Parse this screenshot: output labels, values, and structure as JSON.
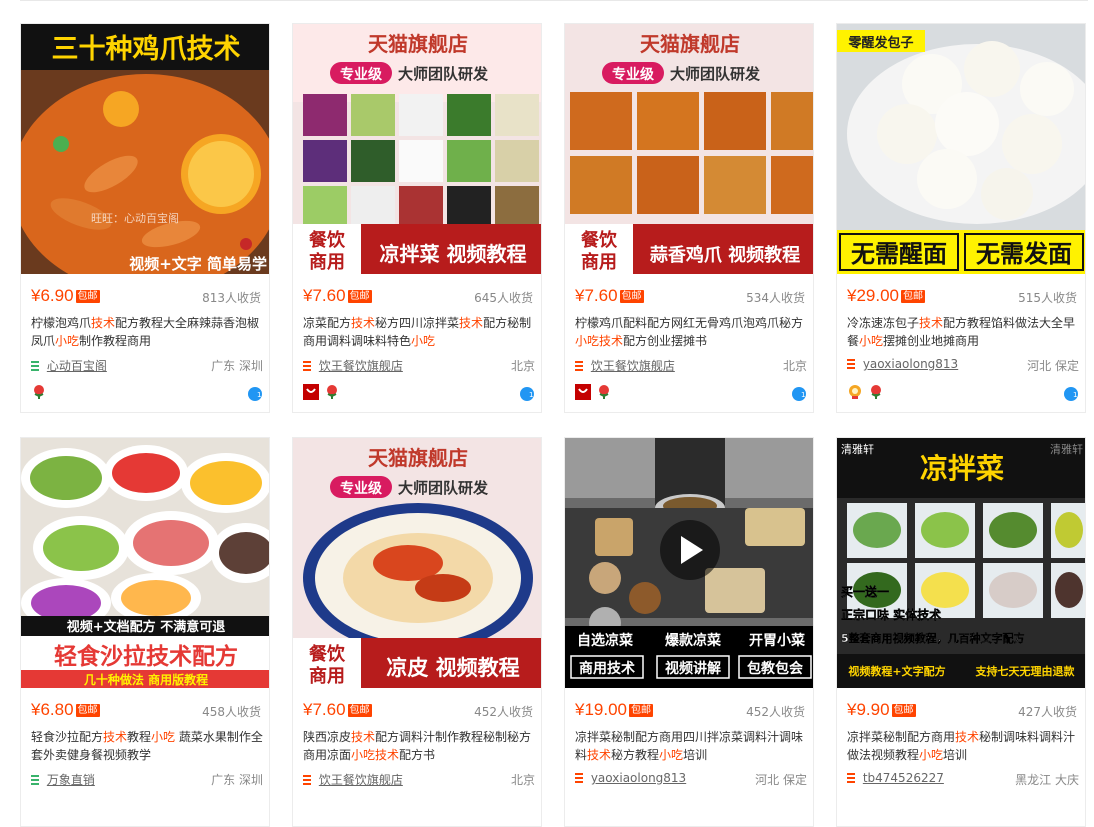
{
  "items": [
    {
      "image_caption": "三十种鸡爪技术",
      "image_sub": "视频+文字 简单易学",
      "image_watermark": "旺旺：心动百宝阁",
      "price": "¥6.90",
      "badge": "包邮",
      "sales": "813人收货",
      "title_parts": [
        "柠檬泡鸡爪",
        "技术",
        "配方教程大全麻辣蒜香泡椒凤爪",
        "小吃",
        "制作教程商用"
      ],
      "shop": "心动百宝阁",
      "shop_color": "#39b36b",
      "location": "广东 深圳",
      "tmall": false
    },
    {
      "image_banner": "天猫旗舰店",
      "image_tag1": "专业级",
      "image_tag2": "大师团队研发",
      "image_side": "餐饮商用",
      "image_caption": "凉拌菜 视频教程",
      "price": "¥7.60",
      "badge": "包邮",
      "sales": "645人收货",
      "title_parts": [
        "凉菜配方",
        "技术",
        "秘方四川凉拌菜",
        "技术",
        "配方秘制商用调料调味料特色",
        "小吃"
      ],
      "shop": "饮王餐饮旗舰店",
      "shop_color": "#ff4400",
      "location": "北京",
      "tmall": true
    },
    {
      "image_banner": "天猫旗舰店",
      "image_tag1": "专业级",
      "image_tag2": "大师团队研发",
      "image_side": "餐饮商用",
      "image_caption": "蒜香鸡爪 视频教程",
      "price": "¥7.60",
      "badge": "包邮",
      "sales": "534人收货",
      "title_parts": [
        "柠檬鸡爪配料配方网红无骨鸡爪泡鸡爪秘方",
        "小吃",
        "",
        "技术",
        "配方创业摆摊书"
      ],
      "shop": "饮王餐饮旗舰店",
      "shop_color": "#ff4400",
      "location": "北京",
      "tmall": true
    },
    {
      "image_corner": "零醒发包子",
      "image_caption_a": "无需醒面",
      "image_caption_b": "无需发面",
      "price": "¥29.00",
      "badge": "包邮",
      "sales": "515人收货",
      "title_parts": [
        "冷冻速冻包子",
        "技术",
        "配方教程馅料做法大全早餐",
        "小吃",
        "摆摊创业地摊商用"
      ],
      "shop": "yaoxiaolong813",
      "shop_color": "#ff4400",
      "location": "河北 保定",
      "tmall": false
    },
    {
      "image_caption_top": "视频+文档配方 不满意可退",
      "image_caption": "轻食沙拉技术配方",
      "image_sub": "几十种做法 商用版教程",
      "price": "¥6.80",
      "badge": "包邮",
      "sales": "458人收货",
      "title_parts": [
        "轻食沙拉配方",
        "技术",
        "教程",
        "小吃",
        " 蔬菜水果制作全套外卖健身餐视频教学"
      ],
      "shop": "万象直销",
      "shop_color": "#39b36b",
      "location": "广东 深圳",
      "tmall": false
    },
    {
      "image_banner": "天猫旗舰店",
      "image_tag1": "专业级",
      "image_tag2": "大师团队研发",
      "image_side": "餐饮商用",
      "image_caption": "凉皮 视频教程",
      "price": "¥7.60",
      "badge": "包邮",
      "sales": "452人收货",
      "title_parts": [
        "陕西凉皮",
        "技术",
        "配方调料汁制作教程秘制秘方商用凉面",
        "小吃技术",
        "配方书"
      ],
      "shop": "饮王餐饮旗舰店",
      "shop_color": "#ff4400",
      "location": "北京",
      "tmall": true
    },
    {
      "image_labels": [
        "自选凉菜",
        "爆款凉菜",
        "开胃小菜"
      ],
      "image_boxes": [
        "商用技术",
        "视频讲解",
        "包教包会"
      ],
      "price": "¥19.00",
      "badge": "包邮",
      "sales": "452人收货",
      "title_parts": [
        "凉拌菜秘制配方商用四川拌凉菜调料汁调味料",
        "技术",
        "秘方教程",
        "小吃",
        "培训"
      ],
      "shop": "yaoxiaolong813",
      "shop_color": "#ff4400",
      "location": "河北 保定",
      "tmall": false
    },
    {
      "image_corner": "清雅轩",
      "image_corner_r": "清雅轩",
      "image_caption": "凉拌菜",
      "image_lines": [
        "买一送一",
        "正宗口味 实体技术",
        "5整套商用视频教程，几百种文字配方"
      ],
      "image_foot_a": "视频教程+文字配方",
      "image_foot_b": "支持七天无理由退款",
      "price": "¥9.90",
      "badge": "包邮",
      "sales": "427人收货",
      "title_parts": [
        "凉拌菜秘制配方商用",
        "技术",
        "秘制调味料调料汁做法视频教程",
        "小吃",
        "培训"
      ],
      "shop": "tb474526227",
      "shop_color": "#ff4400",
      "location": "黑龙江 大庆",
      "tmall": false
    }
  ]
}
